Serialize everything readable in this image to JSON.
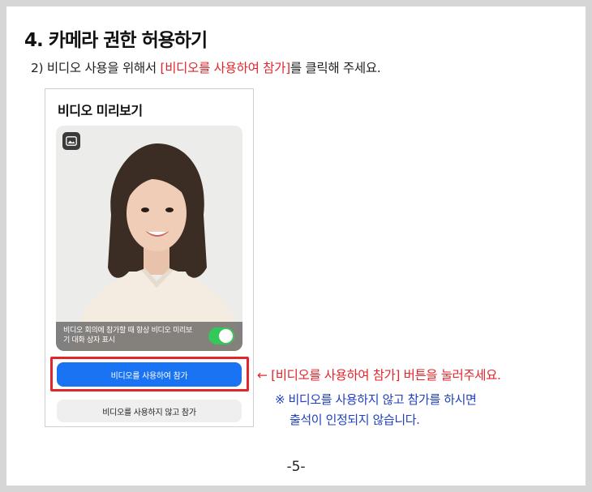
{
  "heading": "4. 카메라 권한 허용하기",
  "instruction": {
    "prefix": "2) 비디오 사용을 위해서 ",
    "highlight": "[비디오를 사용하여 참가]",
    "suffix": "를 클릭해 주세요."
  },
  "phone": {
    "title": "비디오 미리보기",
    "preview_icon": "image-icon",
    "overlay_text": "비디오 회의에 참가할 때 항상 비디오 미리보기 대화 상자 표시",
    "toggle_on": true,
    "join_with_video_label": "비디오를 사용하여 참가",
    "join_without_video_label": "비디오를 사용하지 않고 참가"
  },
  "callout": "← [비디오를 사용하여 참가] 버튼을 눌러주세요.",
  "note": {
    "line1": "※ 비디오를 사용하지 않고 참가를 하시면",
    "line2": "출석이 인정되지 않습니다."
  },
  "page_number": "-5-",
  "colors": {
    "highlight_red": "#e0262b",
    "note_blue": "#1f3fbf",
    "primary_button": "#1a73f2",
    "toggle_green": "#34c759"
  }
}
